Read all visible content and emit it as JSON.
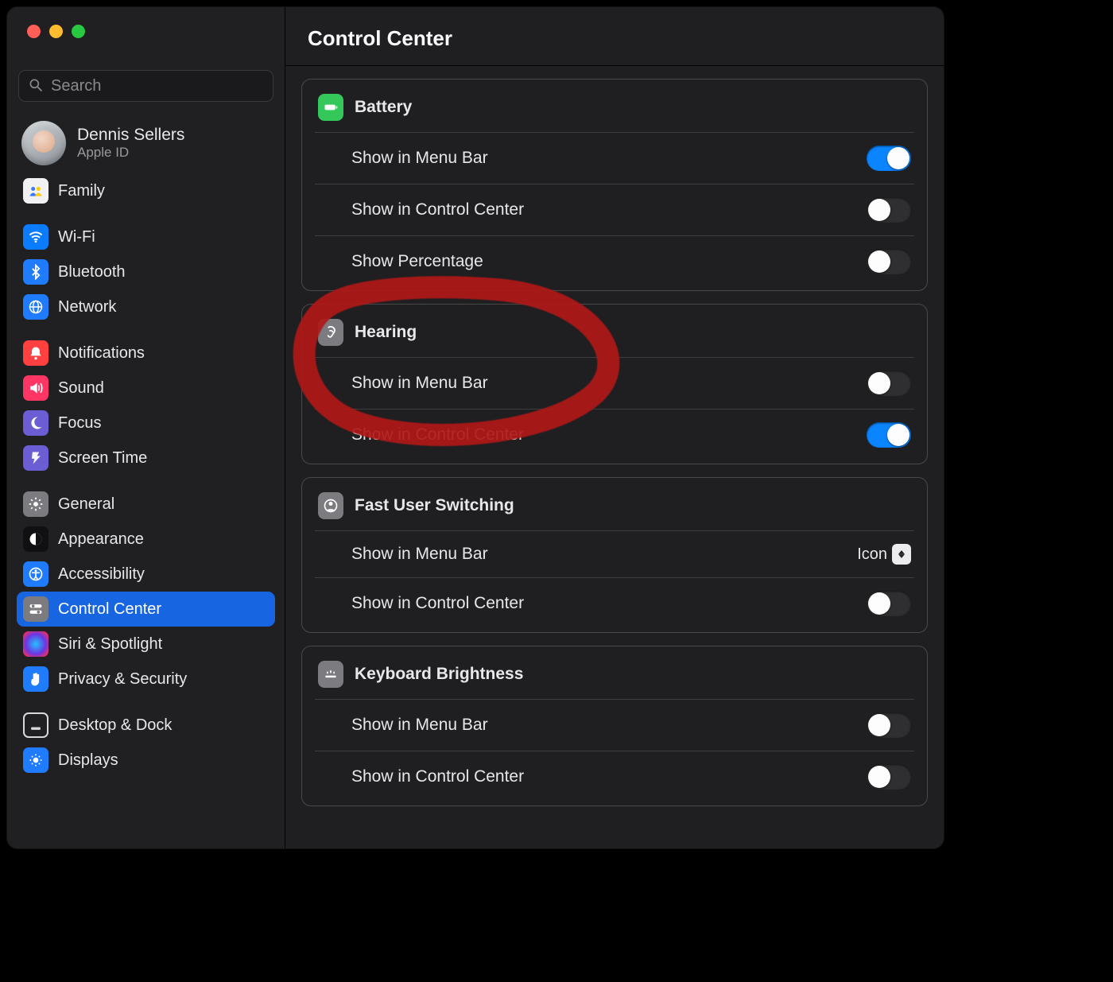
{
  "window": {
    "title": "Control Center"
  },
  "search": {
    "placeholder": "Search"
  },
  "user": {
    "name": "Dennis Sellers",
    "sub": "Apple ID"
  },
  "sidebar": {
    "family": "Family",
    "wifi": "Wi-Fi",
    "bluetooth": "Bluetooth",
    "network": "Network",
    "notifications": "Notifications",
    "sound": "Sound",
    "focus": "Focus",
    "screentime": "Screen Time",
    "general": "General",
    "appearance": "Appearance",
    "accessibility": "Accessibility",
    "controlcenter": "Control Center",
    "siri": "Siri & Spotlight",
    "privacy": "Privacy & Security",
    "desktop": "Desktop & Dock",
    "displays": "Displays"
  },
  "sections": {
    "battery": {
      "title": "Battery",
      "menubar": {
        "label": "Show in Menu Bar",
        "on": true
      },
      "cc": {
        "label": "Show in Control Center",
        "on": false
      },
      "pct": {
        "label": "Show Percentage",
        "on": false
      }
    },
    "hearing": {
      "title": "Hearing",
      "menubar": {
        "label": "Show in Menu Bar",
        "on": false
      },
      "cc": {
        "label": "Show in Control Center",
        "on": true
      }
    },
    "fus": {
      "title": "Fast User Switching",
      "menubar": {
        "label": "Show in Menu Bar",
        "value": "Icon"
      },
      "cc": {
        "label": "Show in Control Center",
        "on": false
      }
    },
    "kb": {
      "title": "Keyboard Brightness",
      "menubar": {
        "label": "Show in Menu Bar",
        "on": false
      },
      "cc": {
        "label": "Show in Control Center",
        "on": false
      }
    }
  }
}
